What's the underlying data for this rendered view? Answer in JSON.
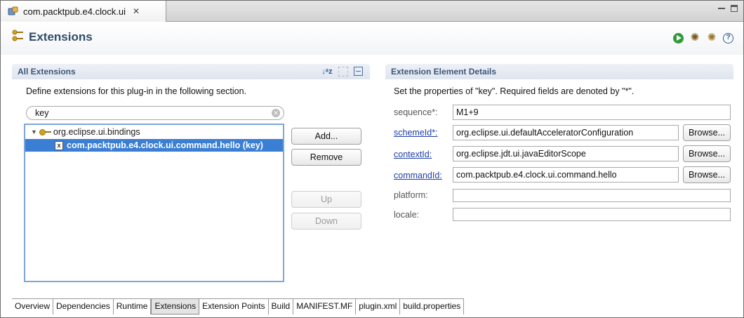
{
  "editor_tab": {
    "title": "com.packtpub.e4.clock.ui",
    "close_glyph": "✕"
  },
  "header": {
    "title": "Extensions"
  },
  "left": {
    "title": "All Extensions",
    "description": "Define extensions for this plug-in in the following section.",
    "filter_value": "key",
    "tree": [
      {
        "label": "org.eclipse.ui.bindings",
        "expanded": true
      },
      {
        "label": "com.packtpub.e4.clock.ui.command.hello (key)",
        "selected": true
      }
    ],
    "buttons": {
      "add": "Add...",
      "remove": "Remove",
      "up": "Up",
      "down": "Down"
    }
  },
  "right": {
    "title": "Extension Element Details",
    "description": "Set the properties of \"key\". Required fields are denoted by \"*\".",
    "fields": {
      "sequence": {
        "label": "sequence*:",
        "value": "M1+9"
      },
      "schemeId": {
        "label": "schemeId*:",
        "value": "org.eclipse.ui.defaultAcceleratorConfiguration"
      },
      "contextId": {
        "label": "contextId:",
        "value": "org.eclipse.jdt.ui.javaEditorScope"
      },
      "commandId": {
        "label": "commandId:",
        "value": "com.packtpub.e4.clock.ui.command.hello"
      },
      "platform": {
        "label": "platform:",
        "value": ""
      },
      "locale": {
        "label": "locale:",
        "value": ""
      }
    },
    "browse_label": "Browse..."
  },
  "bottom_tabs": [
    "Overview",
    "Dependencies",
    "Runtime",
    "Extensions",
    "Extension Points",
    "Build",
    "MANIFEST.MF",
    "plugin.xml",
    "build.properties"
  ],
  "active_bottom_tab": "Extensions",
  "colors": {
    "selection": "#3a7fd4",
    "section_title": "#3a5679",
    "link": "#1f3fa6"
  }
}
